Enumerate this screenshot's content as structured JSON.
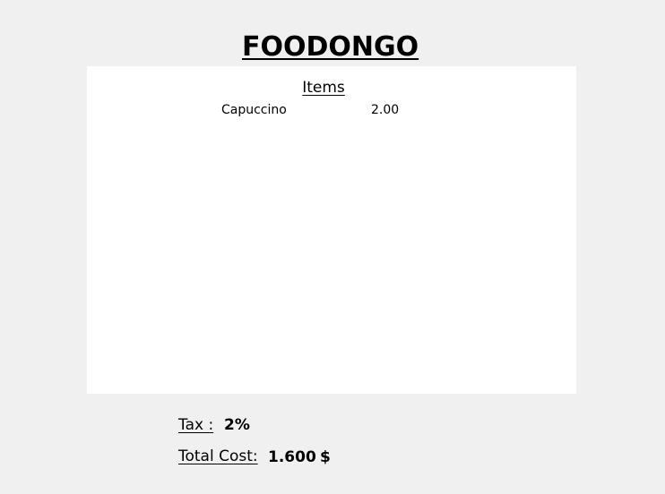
{
  "header": {
    "brand": "FOODONGO"
  },
  "items_panel": {
    "heading": "Items",
    "items": [
      {
        "name": "Capuccino",
        "price": "2.00"
      }
    ]
  },
  "summary": {
    "tax_label": "Tax :",
    "tax_value": "2%",
    "total_label": "Total Cost:",
    "total_value": "1.600",
    "currency": "$"
  }
}
